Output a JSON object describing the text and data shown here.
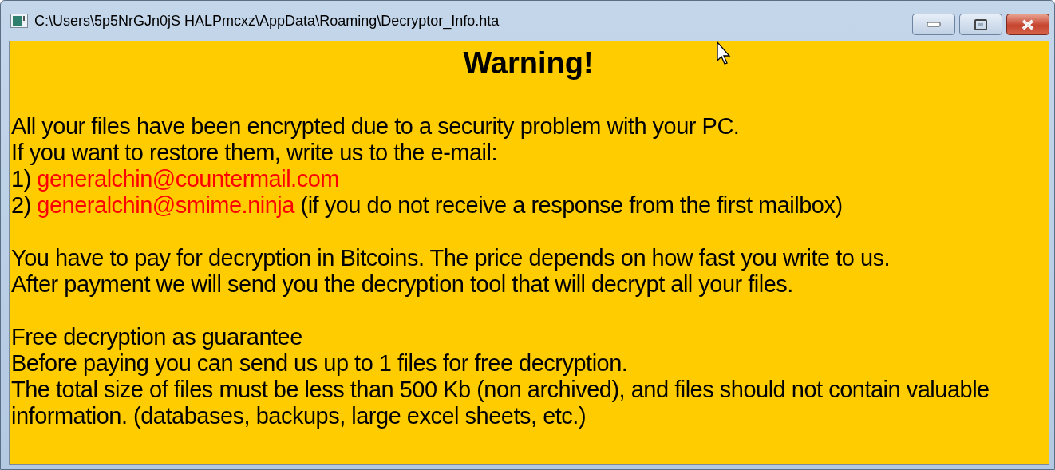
{
  "window": {
    "title": "C:\\Users\\5p5NrGJn0jS HALPmcxz\\AppData\\Roaming\\Decryptor_Info.hta"
  },
  "heading": "Warning!",
  "paragraphs": [
    [
      {
        "text": "All your files have been encrypted due to a security problem with your PC."
      },
      {
        "text": "If you want to restore them, write us to the e-mail:"
      },
      {
        "prefix": "1) ",
        "link": "generalchin@countermail.com"
      },
      {
        "prefix": "2) ",
        "link": "generalchin@smime.ninja",
        "suffix": " (if you do not receive a response from the first mailbox)"
      }
    ],
    [
      {
        "text": "You have to pay for decryption in Bitcoins. The price depends on how fast you write to us."
      },
      {
        "text": "After payment we will send you the decryption tool that will decrypt all your files."
      }
    ],
    [
      {
        "text": "Free decryption as guarantee"
      },
      {
        "text": "Before paying you can send us up to 1 files for free decryption."
      },
      {
        "text": "The total size of files must be less than 500 Kb (non archived), and files should not contain valuable information. (databases, backups, large excel sheets, etc.)"
      }
    ]
  ]
}
